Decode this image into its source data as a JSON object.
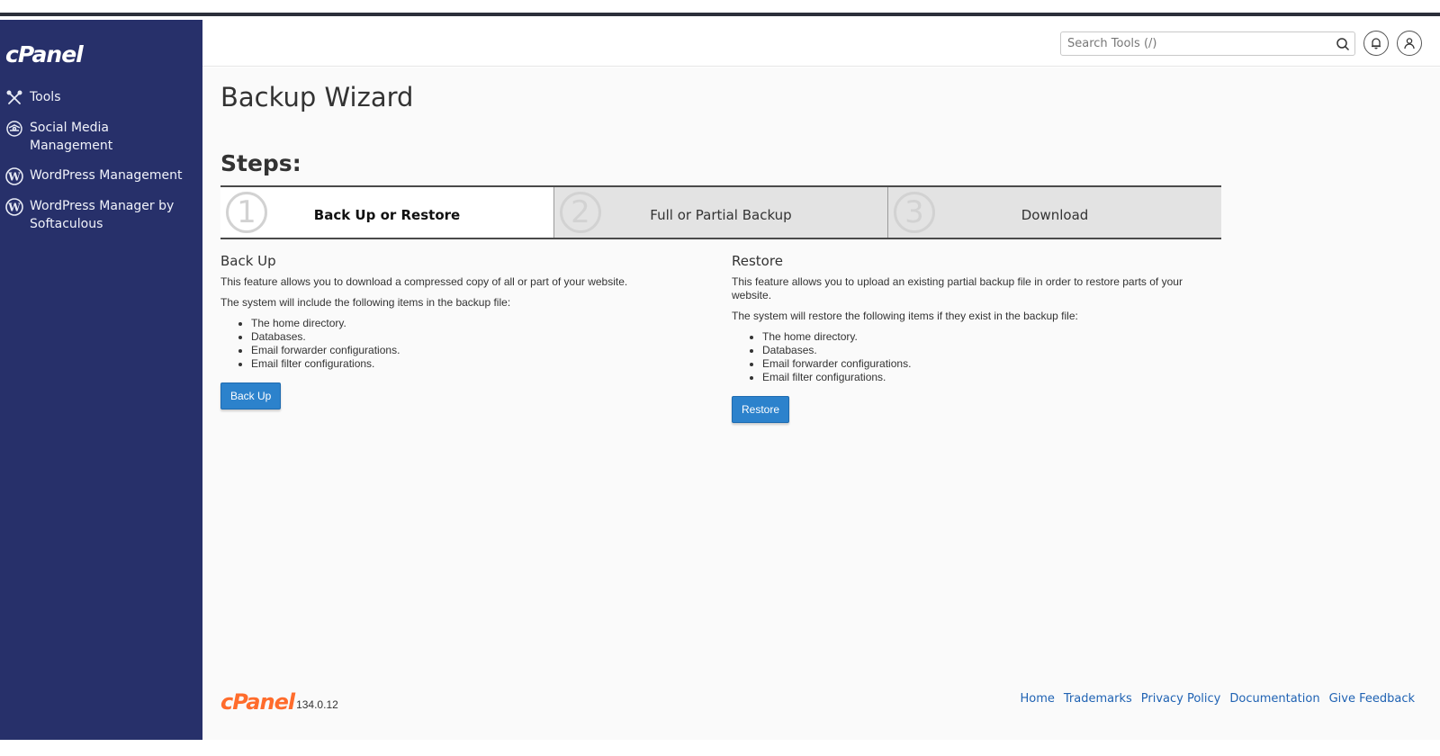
{
  "sidebar": {
    "logo": "cPanel",
    "items": [
      {
        "label": "Tools",
        "icon": "tools-icon"
      },
      {
        "label": "Social Media Management",
        "icon": "social-media-icon"
      },
      {
        "label": "WordPress Management",
        "icon": "wordpress-icon"
      },
      {
        "label": "WordPress Manager by Softaculous",
        "icon": "wordpress-icon"
      }
    ]
  },
  "header": {
    "search_placeholder": "Search Tools (/)",
    "icons": [
      "search-icon",
      "bell-icon",
      "user-icon"
    ]
  },
  "main": {
    "title": "Backup Wizard",
    "steps_title": "Steps:",
    "steps": [
      {
        "number": "1",
        "label": "Back Up or Restore",
        "active": true
      },
      {
        "number": "2",
        "label": "Full or Partial Backup",
        "active": false
      },
      {
        "number": "3",
        "label": "Download",
        "active": false
      }
    ],
    "backup": {
      "heading": "Back Up",
      "description": "This feature allows you to download a compressed copy of all or part of your website.",
      "list_intro": "The system will include the following items in the backup file:",
      "items": [
        "The home directory.",
        "Databases.",
        "Email forwarder configurations.",
        "Email filter configurations."
      ],
      "button": "Back Up"
    },
    "restore": {
      "heading": "Restore",
      "description": "This feature allows you to upload an existing partial backup file in order to restore parts of your website.",
      "list_intro": "The system will restore the following items if they exist in the backup file:",
      "items": [
        "The home directory.",
        "Databases.",
        "Email forwarder configurations.",
        "Email filter configurations."
      ],
      "button": "Restore"
    }
  },
  "footer": {
    "logo": "cPanel",
    "version": "134.0.12",
    "links": [
      "Home",
      "Trademarks",
      "Privacy Policy",
      "Documentation",
      "Give Feedback"
    ]
  },
  "colors": {
    "sidebar_bg": "#27306a",
    "button_blue": "#2c82cc",
    "brand_orange": "#ff6c2c",
    "link_blue": "#1f62b3"
  }
}
